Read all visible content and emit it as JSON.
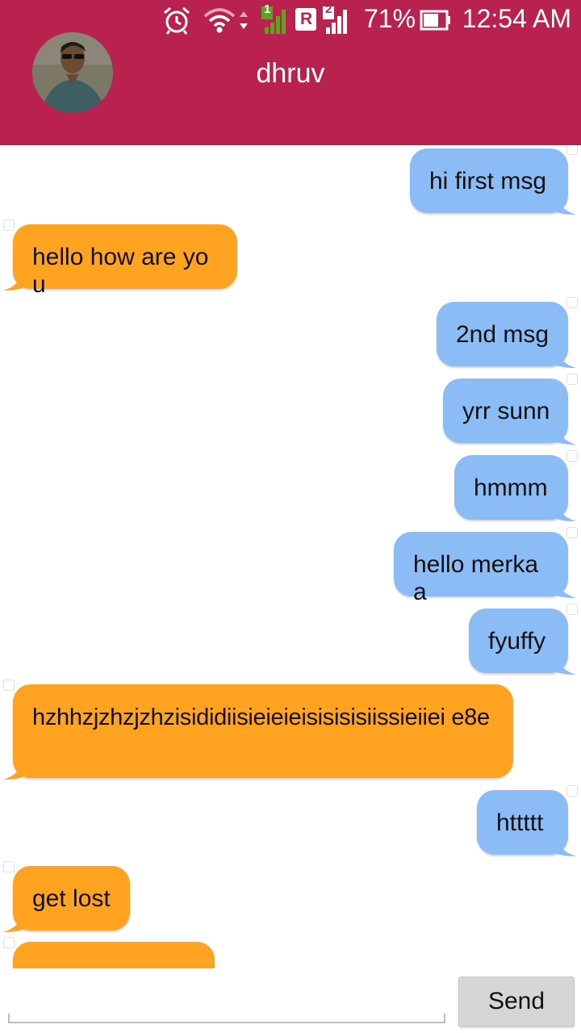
{
  "status_bar": {
    "battery_percent": "71%",
    "time": "12:54 AM",
    "sim1_label": "1",
    "sim2_label": "2",
    "roaming_label": "R",
    "icons": [
      "alarm-icon",
      "wifi-icon",
      "data-arrows-icon",
      "signal-sim1-icon",
      "roaming-icon",
      "signal-sim2-icon",
      "battery-icon"
    ]
  },
  "header": {
    "contact_name": "dhruv",
    "avatar": "contact-avatar"
  },
  "colors": {
    "header": "#b9214f",
    "outgoing_bubble": "#8cbcf6",
    "incoming_bubble": "#ffa320"
  },
  "messages": [
    {
      "direction": "out",
      "text": "hi first msg"
    },
    {
      "direction": "in",
      "text": "hello how are you"
    },
    {
      "direction": "out",
      "text": "2nd msg"
    },
    {
      "direction": "out",
      "text": "yrr sunn"
    },
    {
      "direction": "out",
      "text": "hmmm"
    },
    {
      "direction": "out",
      "text": "hello merkaa"
    },
    {
      "direction": "out",
      "text": "fyuffy"
    },
    {
      "direction": "in",
      "text": "hzhhzjzhzjzhzisididiisieieieisisisisiissieiiei e8e"
    },
    {
      "direction": "out",
      "text": "httttt"
    },
    {
      "direction": "in",
      "text": "get lost"
    },
    {
      "direction": "in",
      "text": ""
    }
  ],
  "composer": {
    "input_value": "",
    "send_label": "Send"
  }
}
